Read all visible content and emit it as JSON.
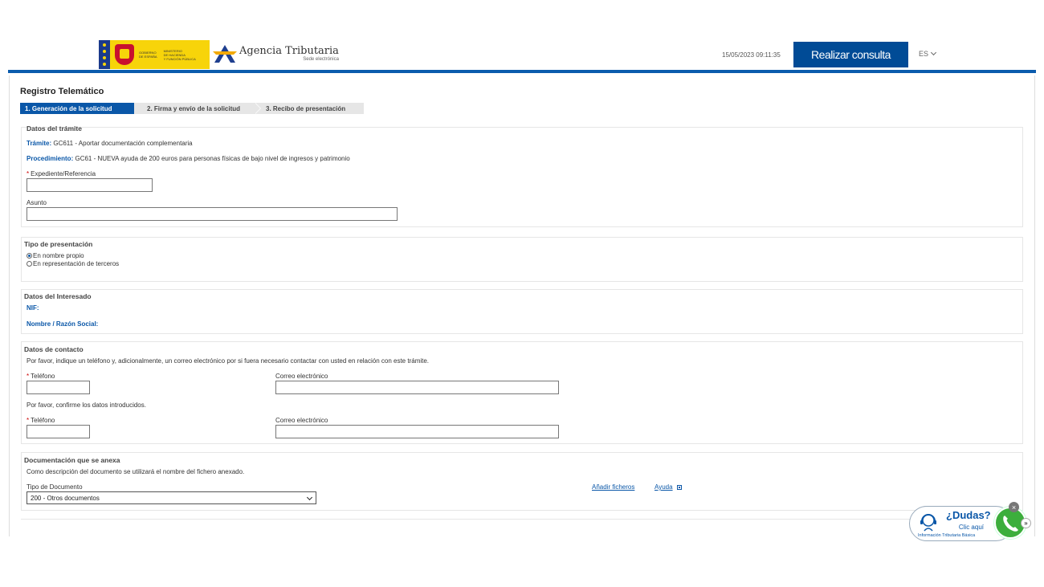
{
  "header": {
    "gov_line1": [
      "GOBIERNO",
      "DE ESPAÑA"
    ],
    "gov_line2": [
      "MINISTERIO",
      "DE HACIENDA",
      "Y FUNCIÓN PÚBLICA"
    ],
    "agency_title": "Agencia Tributaria",
    "agency_subtitle": "Sede electrónica",
    "datetime": "15/05/2023 09:11:35",
    "consulta_label": "Realizar consulta",
    "language": "ES",
    "accent": "#0b5cad",
    "button_color": "#004b96"
  },
  "page": {
    "title": "Registro Telemático",
    "steps": [
      {
        "label": "1. Generación de la solicitud",
        "active": true
      },
      {
        "label": "2. Firma y envío de la solicitud",
        "active": false
      },
      {
        "label": "3. Recibo de presentación",
        "active": false
      }
    ]
  },
  "datos_tramite": {
    "title": "Datos del trámite",
    "tramite_label": "Trámite:",
    "tramite_value": "GC611 - Aportar documentación complementaria",
    "procedimiento_label": "Procedimiento:",
    "procedimiento_value": "GC61 - NUEVA ayuda de 200 euros para personas físicas de bajo nivel de ingresos y patrimonio",
    "expediente_label": "Expediente/Referencia",
    "expediente_value": "",
    "asunto_label": "Asunto",
    "asunto_value": ""
  },
  "tipo_presentacion": {
    "title": "Tipo de presentación",
    "options": [
      {
        "label": "En nombre propio",
        "checked": true
      },
      {
        "label": "En representación de terceros",
        "checked": false
      }
    ]
  },
  "datos_interesado": {
    "title": "Datos del Interesado",
    "nif_label": "NIF:",
    "nombre_label": "Nombre / Razón Social:"
  },
  "datos_contacto": {
    "title": "Datos de contacto",
    "intro": "Por favor, indique un teléfono y, adicionalmente, un correo electrónico por si fuera necesario contactar con usted en relación con este trámite.",
    "telefono_label": "Teléfono",
    "correo_label": "Correo electrónico",
    "confirm_text": "Por favor, confirme los datos introducidos.",
    "telefono2_label": "Teléfono",
    "correo2_label": "Correo electrónico"
  },
  "documentacion": {
    "title": "Documentación que se anexa",
    "description": "Como descripción del documento se utilizará el nombre del fichero anexado.",
    "tipo_label": "Tipo de Documento",
    "tipo_selected": "200 - Otros documentos",
    "add_files": "Añadir ficheros",
    "help": "Ayuda"
  },
  "dudas_widget": {
    "title": "¿Dudas?",
    "click": "Clic aquí",
    "info": "Información Tributaria Básica",
    "close": "×",
    "expand": "»",
    "phone_color": "#3cae3c"
  }
}
